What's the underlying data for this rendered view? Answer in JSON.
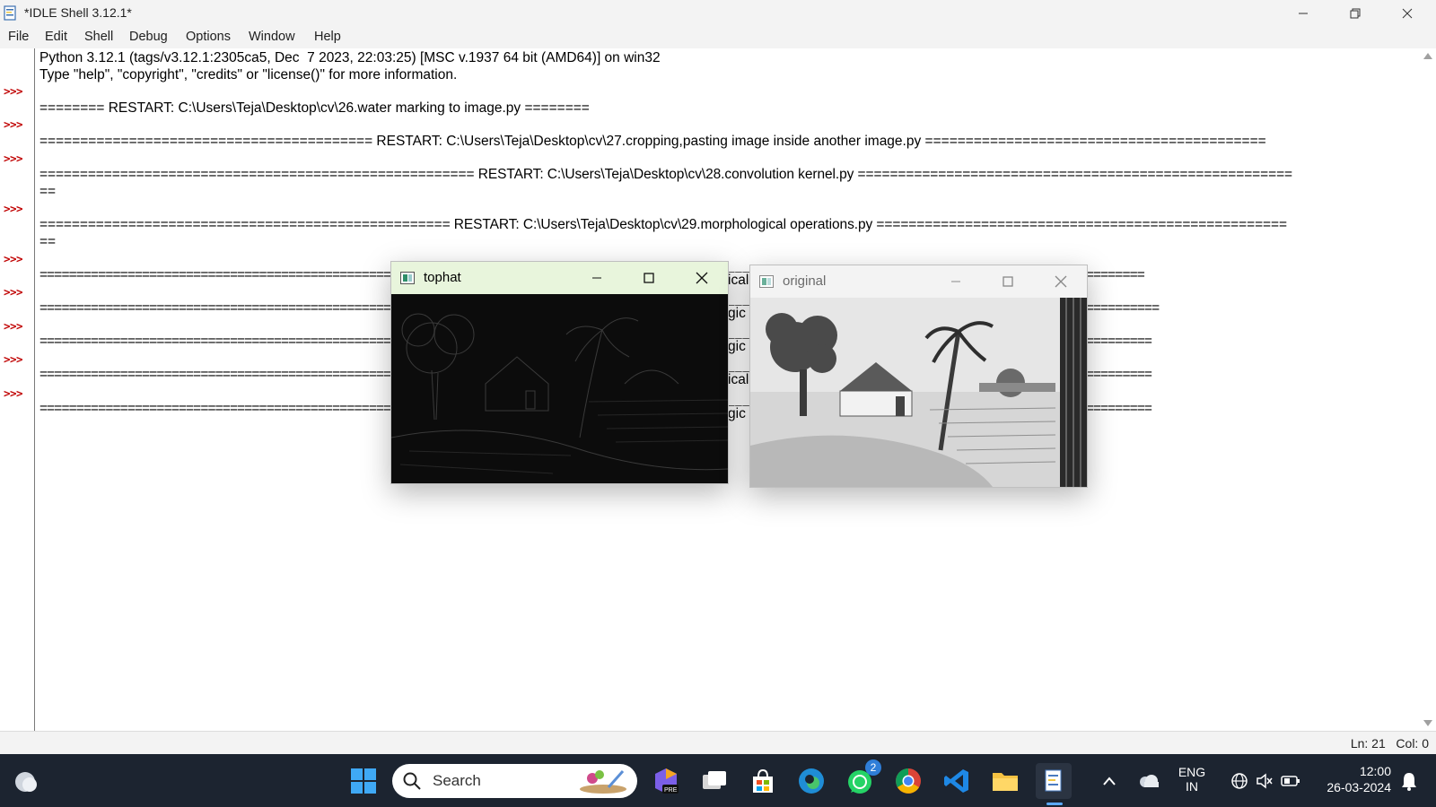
{
  "window": {
    "title": "*IDLE Shell 3.12.1*"
  },
  "menu": [
    "File",
    "Edit",
    "Shell",
    "Debug",
    "Options",
    "Window",
    "Help"
  ],
  "prompts": [
    ">>>",
    ">>>",
    ">>>",
    ">>>",
    ">>>",
    ">>>",
    ">>>",
    ">>>",
    ">>>",
    ">>>"
  ],
  "shell": {
    "lines": [
      "Python 3.12.1 (tags/v3.12.1:2305ca5, Dec  7 2023, 22:03:25) [MSC v.1937 64 bit (AMD64)] on win32",
      "Type \"help\", \"copyright\", \"credits\" or \"license()\" for more information.",
      "======== RESTART: C:\\Users\\Teja\\Desktop\\cv\\26.water marking to image.py ========",
      "========================================= RESTART: C:\\Users\\Teja\\Desktop\\cv\\27.cropping,pasting image inside another image.py ==========================================",
      "====================================================== RESTART: C:\\Users\\Teja\\Desktop\\cv\\28.convolution kernel.py ======================================================",
      "==",
      "=================================================== RESTART: C:\\Users\\Teja\\Desktop\\cv\\29.morphological operations.py ===================================================",
      "==",
      "=======================================================================================================================================================",
      "=========================================================================================================================================================",
      "========================================================================================================================================================",
      "========================================================================================================================================================",
      "========================================================================================================================================================"
    ],
    "fragments": [
      "ical",
      "gic",
      "gic",
      "ical",
      "gic"
    ]
  },
  "status": {
    "text": "Ln: 21   Col: 0"
  },
  "cv_windows": {
    "tophat": {
      "title": "tophat"
    },
    "original": {
      "title": "original"
    }
  },
  "taskbar": {
    "search_label": "Search",
    "whatsapp_badge": "2",
    "lang_line1": "ENG",
    "lang_line2": "IN",
    "time": "12:00",
    "date": "26-03-2024"
  },
  "colors": {
    "prompt": "#c00000",
    "tophat_titlebar": "#e8f5dc",
    "taskbar": "#1c2430"
  }
}
